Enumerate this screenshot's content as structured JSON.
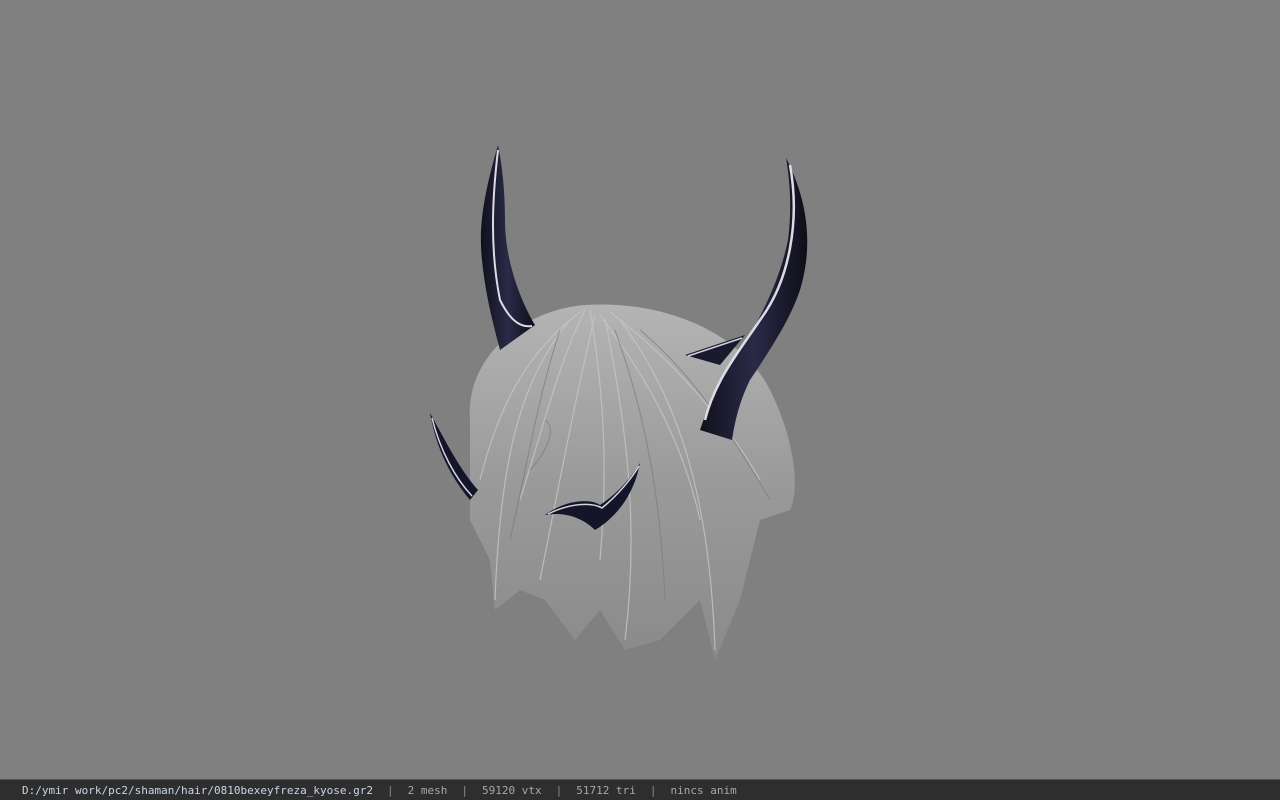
{
  "viewer": {
    "background_color": "#808080",
    "model": {
      "hair_color": "#9a9a9a",
      "horn_color": "#1a1a2e",
      "horn_highlight": "#d8d8e4"
    }
  },
  "statusbar": {
    "file_path": "D:/ymir work/pc2/shaman/hair/0810bexeyfreza_kyose.gr2",
    "separator": "|",
    "mesh_count": "2 mesh",
    "vertex_count": "59120 vtx",
    "triangle_count": "51712 tri",
    "anim_status": "nincs anim"
  }
}
